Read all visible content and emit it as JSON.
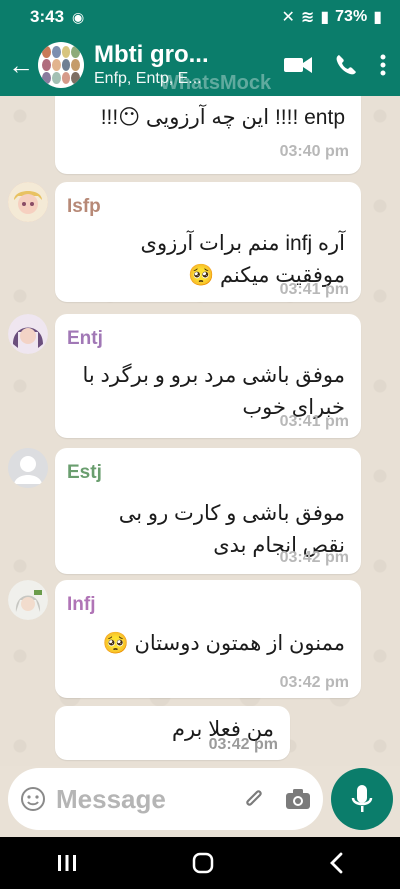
{
  "status": {
    "time": "3:43",
    "battery": "73%"
  },
  "header": {
    "title": "Mbti gro...",
    "subtitle": "Enfp, Entp, E...",
    "watermark": "WhatsMock"
  },
  "messages": [
    {
      "sender": "",
      "text": "entp !!!! این چه آرزویی 😶!!!",
      "time": "03:40 pm"
    },
    {
      "sender": "Isfp",
      "line1": "آره infj منم برات آرزوی",
      "line2": "موفقیت میکنم 🥺",
      "time": "03:41 pm",
      "sender_color": "#b78977"
    },
    {
      "sender": "Entj",
      "line1": "موفق باشی مرد برو و برگرد با",
      "line2": "خبرای خوب",
      "time": "03:41 pm",
      "sender_color": "#a178b6"
    },
    {
      "sender": "Estj",
      "line1": "موفق باشی و کارت رو بی",
      "line2": "نقص انجام بدی",
      "time": "03:42 pm",
      "sender_color": "#6a9e6f"
    },
    {
      "sender": "Infj",
      "line1": "ممنون از همتون دوستان 🥺",
      "time": "03:42 pm",
      "sender_color": "#b074b6"
    },
    {
      "sender": "",
      "line1": "من فعلا برم",
      "time": "03:42 pm"
    }
  ],
  "composer": {
    "placeholder": "Message"
  },
  "colors": {
    "header": "#0b7d6b",
    "accent": "#0b7d6b"
  }
}
